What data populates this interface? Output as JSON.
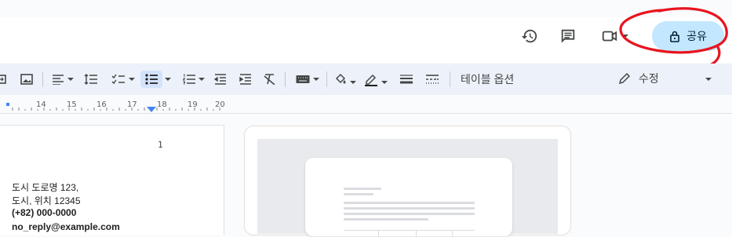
{
  "header": {
    "share_label": "공유",
    "icons": [
      "history-icon",
      "comments-icon",
      "meet-video-icon",
      "lock-icon"
    ]
  },
  "toolbar": {
    "table_options_label": "테이블 옵션",
    "mode_label": "수정"
  },
  "ruler": {
    "numbers": [
      "14",
      "15",
      "16",
      "17",
      "18",
      "19",
      "20"
    ]
  },
  "document": {
    "page_number": "1",
    "address_lines": [
      "도시 도로명 123,",
      "도시, 위치 12345",
      "(+82) 000-0000",
      "no_reply@example.com"
    ]
  },
  "colors": {
    "share_bg": "#c2e7ff",
    "toolbar_bg": "#edf2fa",
    "annotation_red": "#e8141f"
  }
}
